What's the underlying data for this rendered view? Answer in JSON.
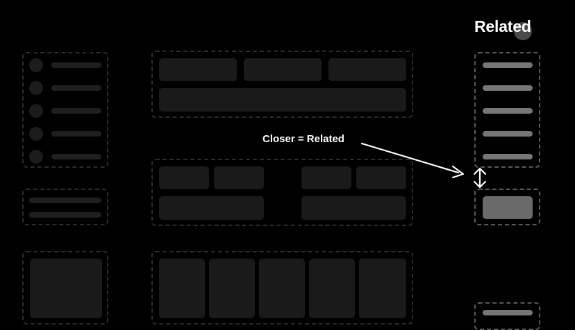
{
  "heading": "Related",
  "callout": "Closer = Related",
  "colors": {
    "background": "#000000",
    "dim_block": "#1a1a1a",
    "dim_border": "#2c2c2c",
    "highlight_block": "#767676",
    "highlight_border": "#5a5a5a",
    "text": "#ffffff"
  },
  "icons": {
    "pointer": "arrow-icon",
    "spacing": "double-headed-vertical-arrow-icon"
  }
}
